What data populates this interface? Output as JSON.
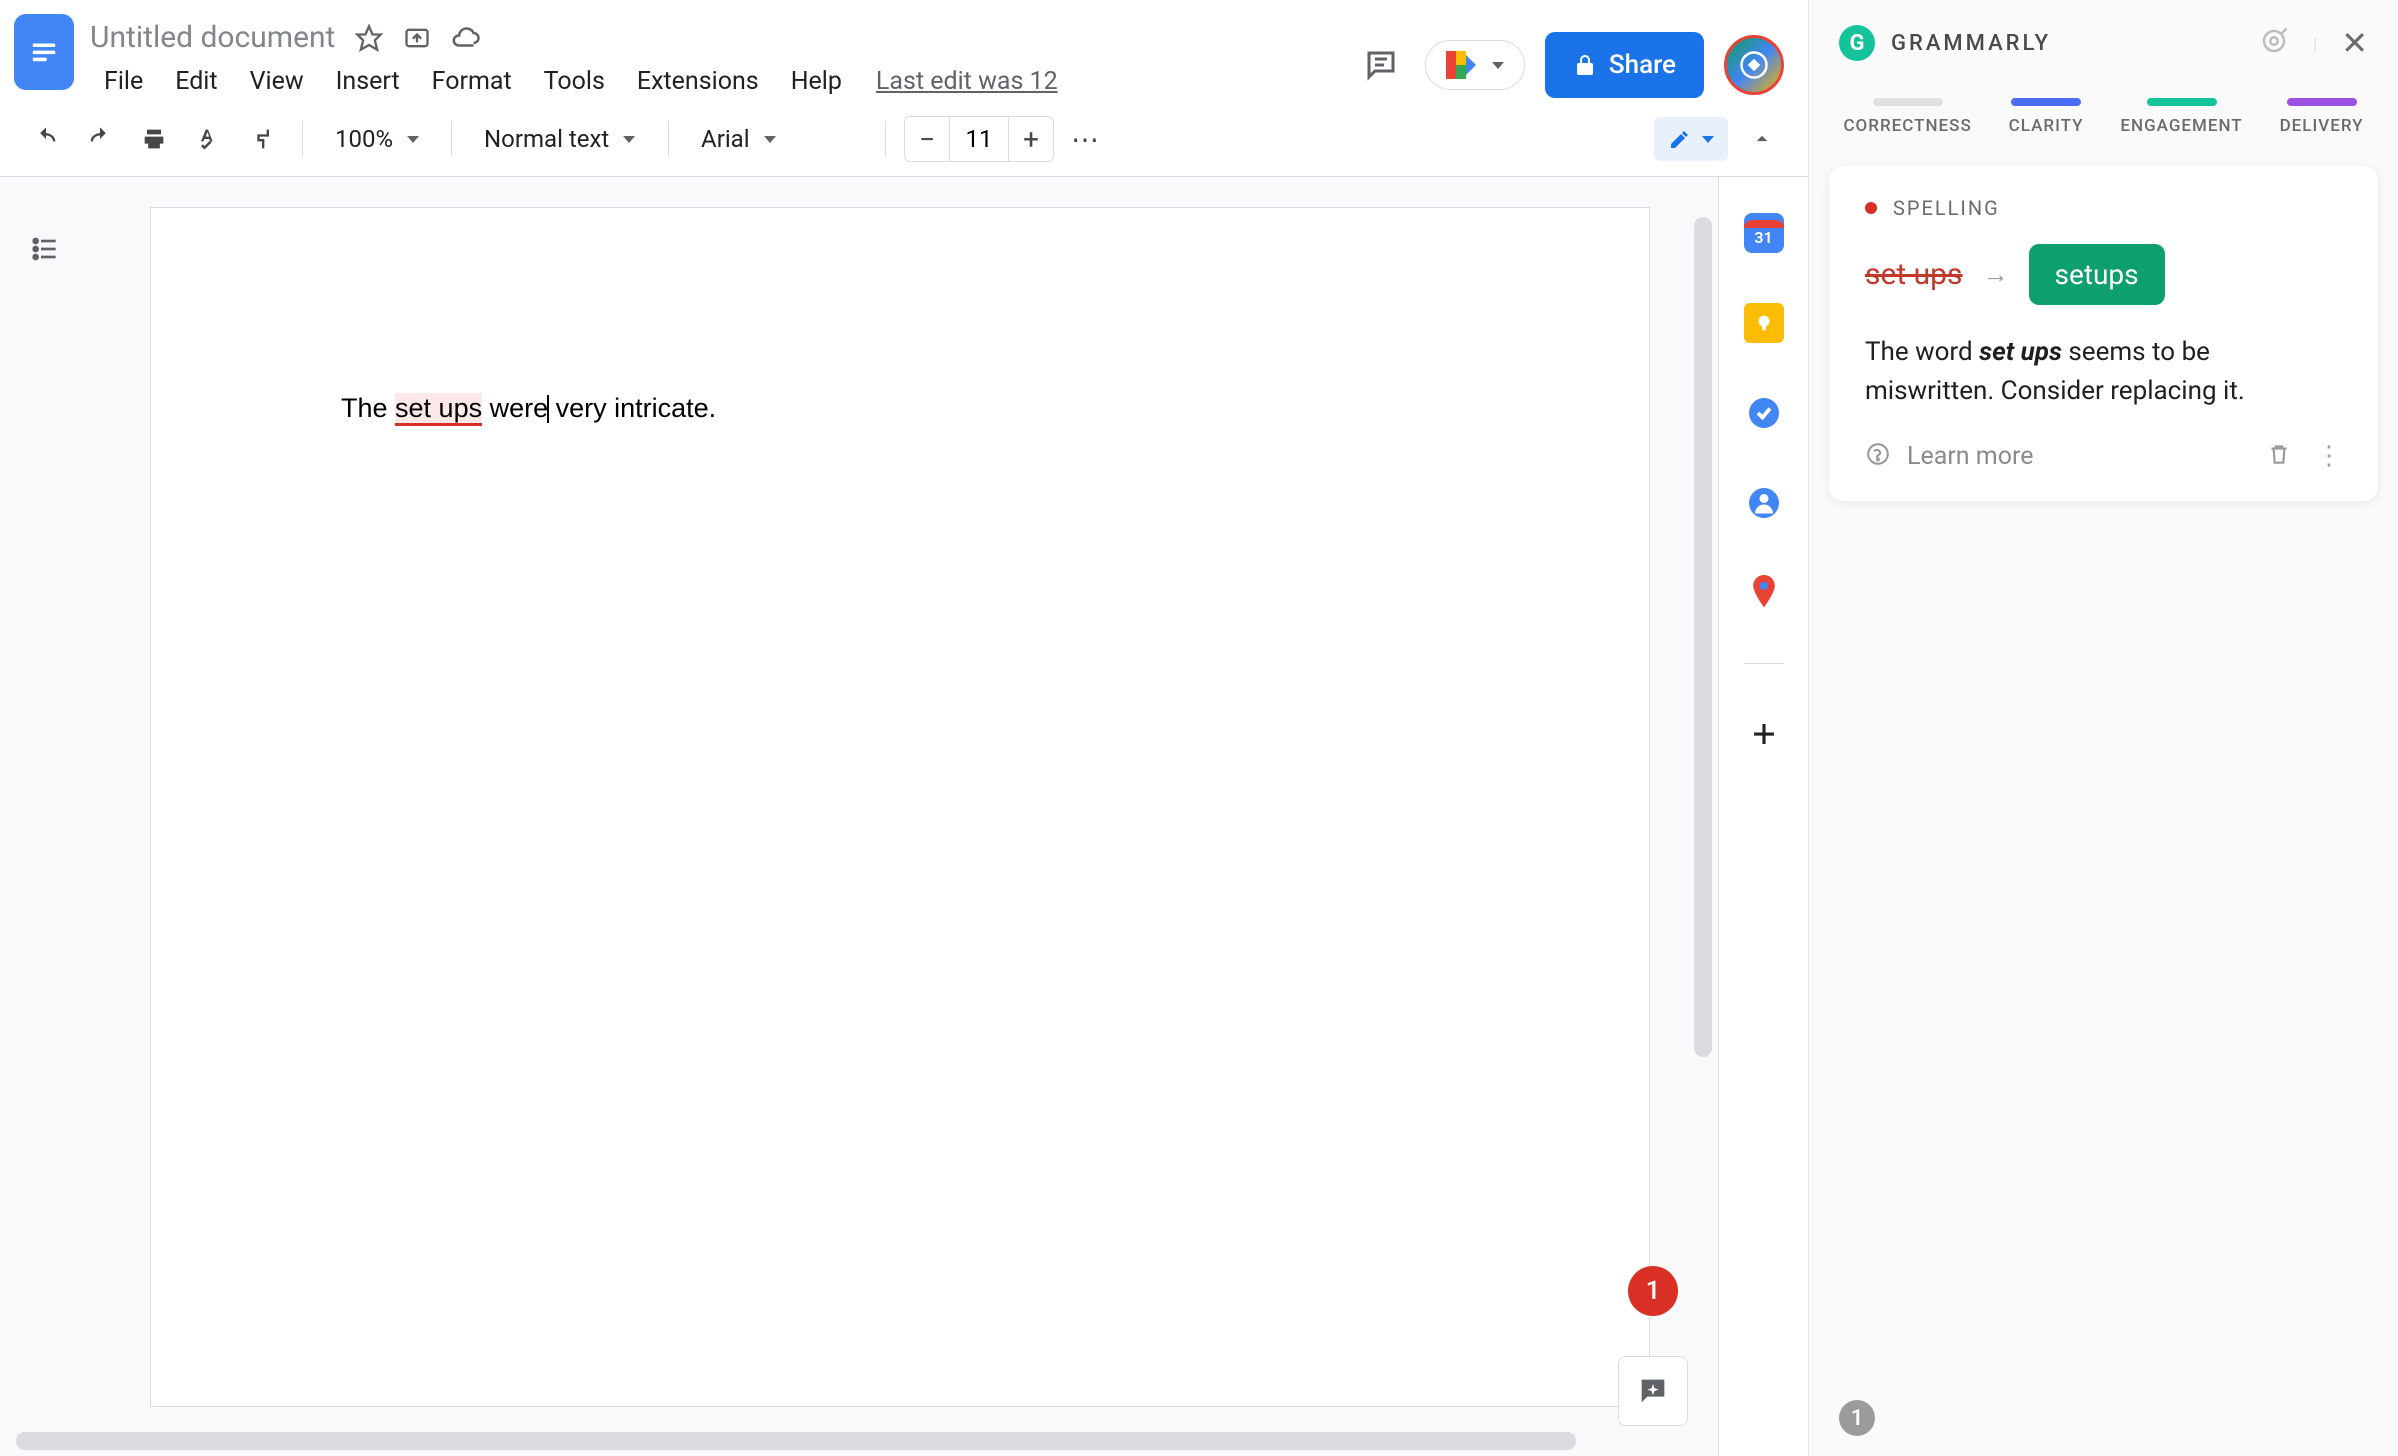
{
  "header": {
    "doc_title": "Untitled document",
    "menu": [
      "File",
      "Edit",
      "View",
      "Insert",
      "Format",
      "Tools",
      "Extensions",
      "Help"
    ],
    "last_edit": "Last edit was 12",
    "share_label": "Share"
  },
  "toolbar": {
    "zoom": "100%",
    "style": "Normal text",
    "font": "Arial",
    "font_size": "11"
  },
  "document": {
    "text_before": "The ",
    "error_text": "set ups",
    "text_mid": " were",
    "text_after": " very intricate."
  },
  "badge": "1",
  "side_panel": {
    "calendar_day": "31"
  },
  "grammarly": {
    "title": "GRAMMARLY",
    "tabs": [
      {
        "label": "CORRECTNESS",
        "color": "#e0e0e0"
      },
      {
        "label": "CLARITY",
        "color": "#4a6cf7"
      },
      {
        "label": "ENGAGEMENT",
        "color": "#15c39a"
      },
      {
        "label": "DELIVERY",
        "color": "#9b51e0"
      }
    ],
    "card": {
      "category": "SPELLING",
      "original": "set ups",
      "suggestion": "setups",
      "desc_before": "The word ",
      "desc_bold": "set ups",
      "desc_after": " seems to be miswritten. Consider replacing it.",
      "learn_more": "Learn more"
    },
    "footer_count": "1"
  }
}
